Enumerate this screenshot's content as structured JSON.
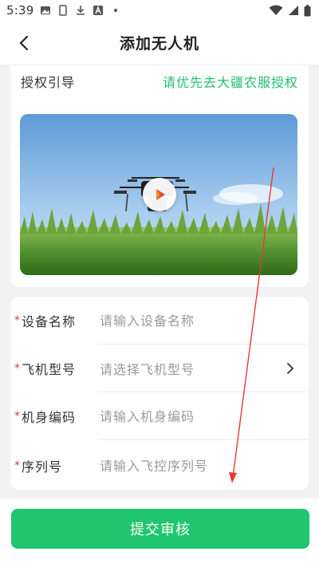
{
  "status_bar": {
    "time": "5:39",
    "left_icons": [
      "image-icon",
      "sim-icon",
      "download-icon",
      "a-icon",
      "dot-icon"
    ],
    "right_icons": [
      "wifi-icon",
      "signal-icon",
      "battery-icon"
    ]
  },
  "header": {
    "title": "添加无人机",
    "back_icon": "chevron-left-icon"
  },
  "auth": {
    "label": "授权引导",
    "link": "请优先去大疆农服授权",
    "link_color": "#1fbf6c"
  },
  "video": {
    "play_icon": "play-icon"
  },
  "form": {
    "fields": [
      {
        "label": "设备名称",
        "placeholder": "请输入设备名称",
        "required": "*"
      },
      {
        "label": "飞机型号",
        "placeholder": "请选择飞机型号",
        "required": "*"
      },
      {
        "label": "机身编码",
        "placeholder": "请输入机身编码",
        "required": "*"
      },
      {
        "label": "序列号",
        "placeholder": "请输入飞控序列号",
        "required": "*"
      }
    ]
  },
  "submit": {
    "label": "提交审核",
    "color": "#20c56f"
  }
}
